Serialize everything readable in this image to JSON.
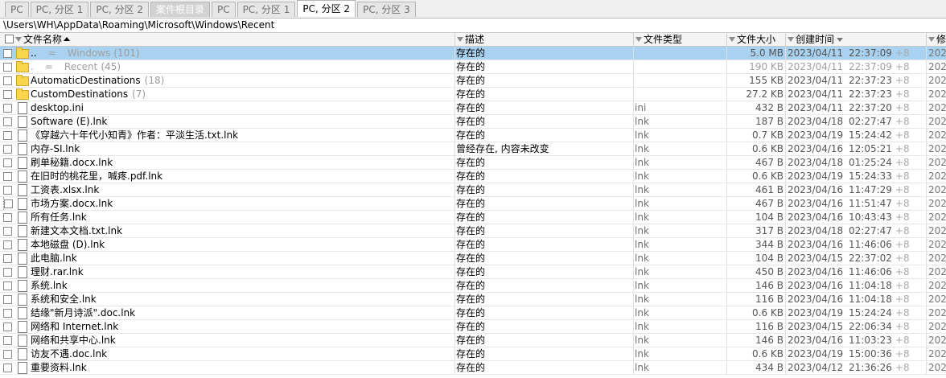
{
  "tabs": [
    {
      "label": "PC",
      "state": "normal"
    },
    {
      "label": "PC, 分区 1",
      "state": "normal"
    },
    {
      "label": "PC, 分区 2",
      "state": "normal"
    },
    {
      "label": "案件根目录",
      "state": "gray"
    },
    {
      "label": "PC",
      "state": "normal"
    },
    {
      "label": "PC, 分区 1",
      "state": "normal"
    },
    {
      "label": "PC, 分区 2",
      "state": "active"
    },
    {
      "label": "PC, 分区 3",
      "state": "normal"
    }
  ],
  "path": "\\Users\\WH\\AppData\\Roaming\\Microsoft\\Windows\\Recent",
  "columns": {
    "name": "文件名称",
    "desc": "描述",
    "type": "文件类型",
    "size": "文件大小",
    "created": "创建时间",
    "more": "修"
  },
  "rows": [
    {
      "icon": "folder",
      "name": "..",
      "eq": "=",
      "name2": "Windows",
      "count": "(101)",
      "desc": "存在的",
      "type": "",
      "size": "5.0 MB",
      "date": "2023/04/11",
      "time": "22:37:09",
      "tz": "+8",
      "more": "202",
      "selected": true
    },
    {
      "icon": "folder",
      "name": ".",
      "eq": "=",
      "name2": "Recent",
      "count": "(45)",
      "desc": "存在的",
      "type": "",
      "size": "190 KB",
      "date": "2023/04/11",
      "time": "22:37:09",
      "tz": "+8",
      "more": "202",
      "dim": true
    },
    {
      "icon": "folder",
      "name": "AutomaticDestinations",
      "count": "(18)",
      "desc": "存在的",
      "type": "",
      "size": "155 KB",
      "date": "2023/04/11",
      "time": "22:37:23",
      "tz": "+8",
      "more": "202"
    },
    {
      "icon": "folder",
      "name": "CustomDestinations",
      "count": "(7)",
      "desc": "存在的",
      "type": "",
      "size": "27.2 KB",
      "date": "2023/04/11",
      "time": "22:37:23",
      "tz": "+8",
      "more": "202"
    },
    {
      "icon": "file",
      "name": "desktop.ini",
      "desc": "存在的",
      "type": "ini",
      "size": "432 B",
      "date": "2023/04/11",
      "time": "22:37:20",
      "tz": "+8",
      "more": "202"
    },
    {
      "icon": "file",
      "name": "Software (E).lnk",
      "desc": "存在的",
      "type": "lnk",
      "size": "187 B",
      "date": "2023/04/18",
      "time": "02:27:47",
      "tz": "+8",
      "more": "202"
    },
    {
      "icon": "file",
      "name": "《穿越六十年代小知青》作者：平淡生活.txt.lnk",
      "desc": "存在的",
      "type": "lnk",
      "size": "0.7 KB",
      "date": "2023/04/19",
      "time": "15:24:42",
      "tz": "+8",
      "more": "202"
    },
    {
      "icon": "file",
      "name": "内存-SI.lnk",
      "desc": "曾经存在, 内容未改变",
      "type": "lnk",
      "size": "0.6 KB",
      "date": "2023/04/16",
      "time": "12:05:21",
      "tz": "+8",
      "more": "202"
    },
    {
      "icon": "file",
      "name": "刷单秘籍.docx.lnk",
      "desc": "存在的",
      "type": "lnk",
      "size": "467 B",
      "date": "2023/04/18",
      "time": "01:25:24",
      "tz": "+8",
      "more": "202"
    },
    {
      "icon": "file",
      "name": "在旧时的桃花里，喊疼.pdf.lnk",
      "desc": "存在的",
      "type": "lnk",
      "size": "0.6 KB",
      "date": "2023/04/19",
      "time": "15:24:33",
      "tz": "+8",
      "more": "202"
    },
    {
      "icon": "file",
      "name": "工资表.xlsx.lnk",
      "desc": "存在的",
      "type": "lnk",
      "size": "461 B",
      "date": "2023/04/16",
      "time": "11:47:29",
      "tz": "+8",
      "more": "202"
    },
    {
      "icon": "file",
      "name": "市场方案.docx.lnk",
      "desc": "存在的",
      "type": "lnk",
      "size": "467 B",
      "date": "2023/04/16",
      "time": "11:51:47",
      "tz": "+8",
      "more": "202",
      "focused": true
    },
    {
      "icon": "file",
      "name": "所有任务.lnk",
      "desc": "存在的",
      "type": "lnk",
      "size": "104 B",
      "date": "2023/04/16",
      "time": "10:43:43",
      "tz": "+8",
      "more": "202"
    },
    {
      "icon": "file",
      "name": "新建文本文档.txt.lnk",
      "desc": "存在的",
      "type": "lnk",
      "size": "317 B",
      "date": "2023/04/18",
      "time": "02:27:47",
      "tz": "+8",
      "more": "202"
    },
    {
      "icon": "file",
      "name": "本地磁盘 (D).lnk",
      "desc": "存在的",
      "type": "lnk",
      "size": "344 B",
      "date": "2023/04/16",
      "time": "11:46:06",
      "tz": "+8",
      "more": "202"
    },
    {
      "icon": "file",
      "name": "此电脑.lnk",
      "desc": "存在的",
      "type": "lnk",
      "size": "104 B",
      "date": "2023/04/15",
      "time": "22:37:02",
      "tz": "+8",
      "more": "202"
    },
    {
      "icon": "file",
      "name": "理财.rar.lnk",
      "desc": "存在的",
      "type": "lnk",
      "size": "450 B",
      "date": "2023/04/16",
      "time": "11:46:06",
      "tz": "+8",
      "more": "202"
    },
    {
      "icon": "file",
      "name": "系统.lnk",
      "desc": "存在的",
      "type": "lnk",
      "size": "146 B",
      "date": "2023/04/16",
      "time": "11:04:18",
      "tz": "+8",
      "more": "202"
    },
    {
      "icon": "file",
      "name": "系统和安全.lnk",
      "desc": "存在的",
      "type": "lnk",
      "size": "116 B",
      "date": "2023/04/16",
      "time": "11:04:18",
      "tz": "+8",
      "more": "202"
    },
    {
      "icon": "file",
      "name": "结缘\"新月诗派\".doc.lnk",
      "desc": "存在的",
      "type": "lnk",
      "size": "0.6 KB",
      "date": "2023/04/19",
      "time": "15:24:24",
      "tz": "+8",
      "more": "202"
    },
    {
      "icon": "file",
      "name": "网络和 Internet.lnk",
      "desc": "存在的",
      "type": "lnk",
      "size": "116 B",
      "date": "2023/04/15",
      "time": "22:06:34",
      "tz": "+8",
      "more": "202"
    },
    {
      "icon": "file",
      "name": "网络和共享中心.lnk",
      "desc": "存在的",
      "type": "lnk",
      "size": "146 B",
      "date": "2023/04/16",
      "time": "11:03:23",
      "tz": "+8",
      "more": "202"
    },
    {
      "icon": "file",
      "name": "访友不遇.doc.lnk",
      "desc": "存在的",
      "type": "lnk",
      "size": "0.6 KB",
      "date": "2023/04/19",
      "time": "15:00:36",
      "tz": "+8",
      "more": "202"
    },
    {
      "icon": "file",
      "name": "重要资料.lnk",
      "desc": "存在的",
      "type": "lnk",
      "size": "434 B",
      "date": "2023/04/12",
      "time": "21:36:26",
      "tz": "+8",
      "more": "202"
    }
  ],
  "colors": {
    "selection": "#a9d1f0",
    "folder": "#f8d54b",
    "dim_text": "#a0a0a0"
  }
}
